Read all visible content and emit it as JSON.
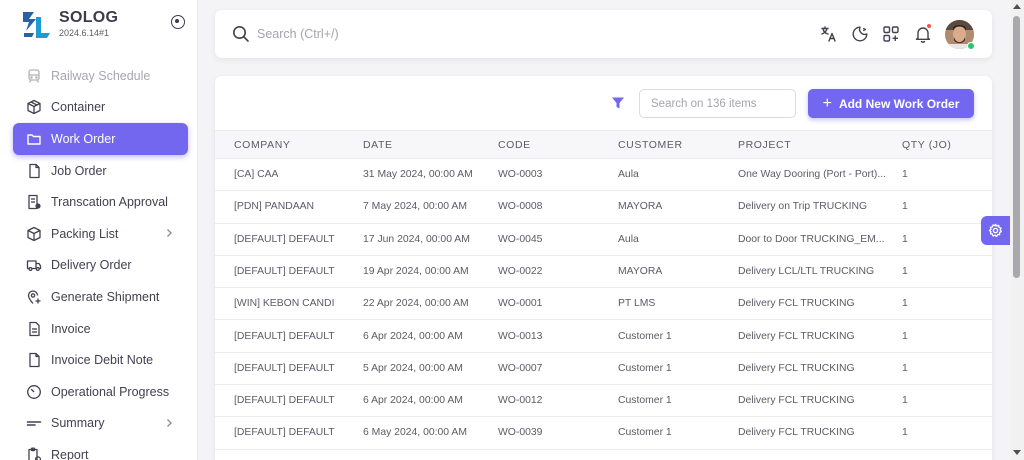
{
  "brand": {
    "name": "SOLOG",
    "version": "2024.6.14#1",
    "color": "#2b5fa6"
  },
  "sidebar": {
    "items": [
      {
        "label": "Railway Schedule",
        "icon": "train-icon",
        "state": "faded"
      },
      {
        "label": "Container",
        "icon": "box-icon",
        "state": ""
      },
      {
        "label": "Work Order",
        "icon": "folder-icon",
        "state": "active"
      },
      {
        "label": "Job Order",
        "icon": "file-icon",
        "state": ""
      },
      {
        "label": "Transcation Approval",
        "icon": "file-approval-icon",
        "state": ""
      },
      {
        "label": "Packing List",
        "icon": "package-icon",
        "state": "",
        "chevron": true
      },
      {
        "label": "Delivery Order",
        "icon": "truck-icon",
        "state": ""
      },
      {
        "label": "Generate Shipment",
        "icon": "map-pin-plus-icon",
        "state": ""
      },
      {
        "label": "Invoice",
        "icon": "invoice-icon",
        "state": ""
      },
      {
        "label": "Invoice Debit Note",
        "icon": "file-blank-icon",
        "state": ""
      },
      {
        "label": "Operational Progress",
        "icon": "gauge-icon",
        "state": ""
      },
      {
        "label": "Summary",
        "icon": "lines-icon",
        "state": "",
        "chevron": true
      },
      {
        "label": "Report",
        "icon": "report-icon",
        "state": ""
      }
    ]
  },
  "topbar": {
    "search_placeholder": "Search (Ctrl+/)"
  },
  "toolbar": {
    "items_search_placeholder": "Search on 136 items",
    "add_label": "Add New Work Order"
  },
  "table": {
    "columns": [
      "COMPANY",
      "DATE",
      "CODE",
      "CUSTOMER",
      "PROJECT",
      "QTY (JO)"
    ],
    "rows": [
      [
        "[CA] CAA",
        "31 May 2024, 00:00 AM",
        "WO-0003",
        "Aula",
        "One Way Dooring (Port - Port)...",
        "1"
      ],
      [
        "[PDN] PANDAAN",
        "7 May 2024, 00:00 AM",
        "WO-0008",
        "MAYORA",
        "Delivery on Trip TRUCKING",
        "1"
      ],
      [
        "[DEFAULT] DEFAULT",
        "17 Jun 2024, 00:00 AM",
        "WO-0045",
        "Aula",
        "Door to Door TRUCKING_EM...",
        "1"
      ],
      [
        "[DEFAULT] DEFAULT",
        "19 Apr 2024, 00:00 AM",
        "WO-0022",
        "MAYORA",
        "Delivery LCL/LTL TRUCKING",
        "1"
      ],
      [
        "[WIN] KEBON CANDI",
        "22 Apr 2024, 00:00 AM",
        "WO-0001",
        "PT LMS",
        "Delivery FCL TRUCKING",
        "1"
      ],
      [
        "[DEFAULT] DEFAULT",
        "6 Apr 2024, 00:00 AM",
        "WO-0013",
        "Customer 1",
        "Delivery FCL TRUCKING",
        "1"
      ],
      [
        "[DEFAULT] DEFAULT",
        "5 Apr 2024, 00:00 AM",
        "WO-0007",
        "Customer 1",
        "Delivery FCL TRUCKING",
        "1"
      ],
      [
        "[DEFAULT] DEFAULT",
        "6 Apr 2024, 00:00 AM",
        "WO-0012",
        "Customer 1",
        "Delivery FCL TRUCKING",
        "1"
      ],
      [
        "[DEFAULT] DEFAULT",
        "6 May 2024, 00:00 AM",
        "WO-0039",
        "Customer 1",
        "Delivery FCL TRUCKING",
        "1"
      ]
    ]
  },
  "colors": {
    "accent": "#7367f0",
    "notification": "#ff4c51",
    "online": "#28c76f"
  }
}
